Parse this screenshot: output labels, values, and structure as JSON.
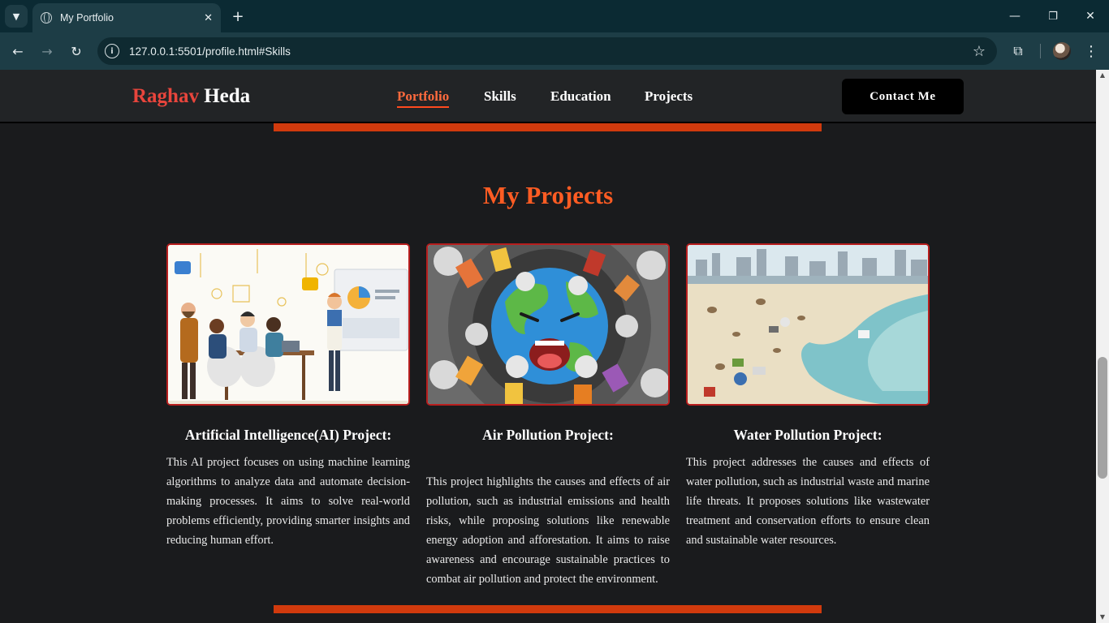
{
  "browser": {
    "tab_title": "My Portfolio",
    "url": "127.0.0.1:5501/profile.html#Skills"
  },
  "header": {
    "logo_first": "Raghav",
    "logo_last": "Heda",
    "nav": [
      {
        "label": "Portfolio",
        "active": true
      },
      {
        "label": "Skills",
        "active": false
      },
      {
        "label": "Education",
        "active": false
      },
      {
        "label": "Projects",
        "active": false
      }
    ],
    "contact_label": "Contact Me"
  },
  "projects": {
    "title": "My Projects",
    "items": [
      {
        "title": "Artificial Intelligence(AI) Project:",
        "description": "This AI project focuses on using machine learning algorithms to analyze data and automate decision-making processes. It aims to solve real-world problems efficiently, providing smarter insights and reducing human effort.",
        "image_icon": "ai-team-illustration"
      },
      {
        "title": "Air Pollution Project:",
        "description": "This project highlights the causes and effects of air pollution, such as industrial emissions and health risks, while proposing solutions like renewable energy adoption and afforestation. It aims to raise awareness and encourage sustainable practices to combat air pollution and protect the environment.",
        "image_icon": "polluted-earth-illustration"
      },
      {
        "title": "Water Pollution Project:",
        "description": "This project addresses the causes and effects of water pollution, such as industrial waste and marine life threats. It proposes solutions like wastewater treatment and conservation efforts to ensure clean and sustainable water resources.",
        "image_icon": "polluted-beach-illustration"
      }
    ]
  },
  "colors": {
    "accent": "#ff5c23",
    "divider": "#d13a0d",
    "logo_first": "#e8453c",
    "background": "#1a1b1d"
  }
}
